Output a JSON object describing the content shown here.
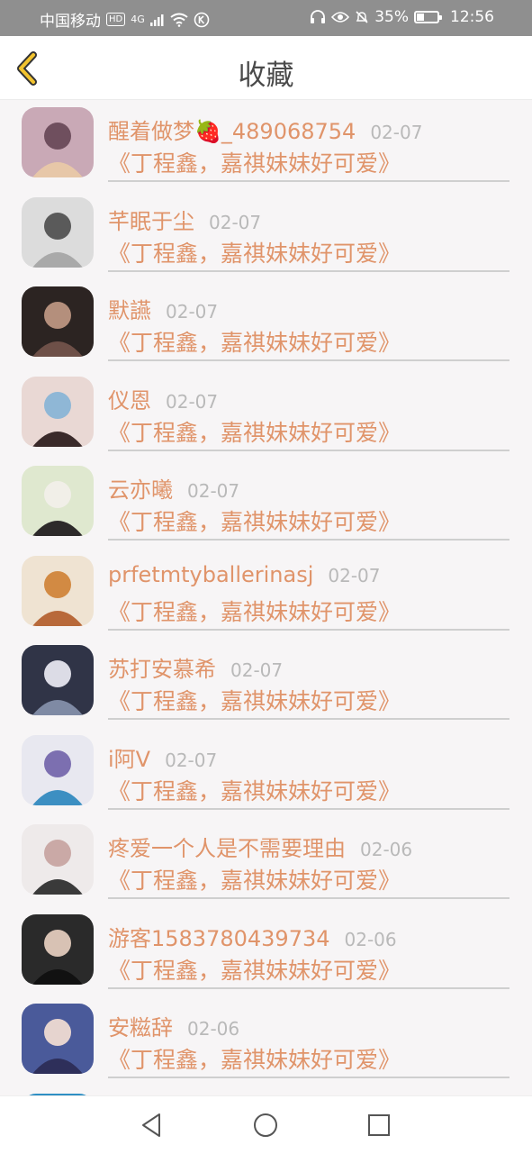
{
  "status_bar": {
    "carrier": "中国移动",
    "hd": "HD",
    "network": "4G",
    "battery_percent": "35%",
    "battery_level": 0.35,
    "time": "12:56"
  },
  "header": {
    "title": "收藏",
    "back_icon": "chevron-left-icon",
    "accent_color": "#f2c32e"
  },
  "colors": {
    "name": "#e0946a",
    "date": "#b9b9b9",
    "divider": "#cfcfcf"
  },
  "items": [
    {
      "name": "醒着做梦🍓_489068754",
      "date": "02-07",
      "title": "《丁程鑫，嘉祺妹妹好可爱》"
    },
    {
      "name": "芊眠于尘",
      "date": "02-07",
      "title": "《丁程鑫，嘉祺妹妹好可爱》"
    },
    {
      "name": "默讌",
      "date": "02-07",
      "title": "《丁程鑫，嘉祺妹妹好可爱》"
    },
    {
      "name": "仪恩",
      "date": "02-07",
      "title": "《丁程鑫，嘉祺妹妹好可爱》"
    },
    {
      "name": "云亦曦",
      "date": "02-07",
      "title": "《丁程鑫，嘉祺妹妹好可爱》"
    },
    {
      "name": "prfetmtyballerinasj",
      "date": "02-07",
      "title": "《丁程鑫，嘉祺妹妹好可爱》"
    },
    {
      "name": "苏打安慕希",
      "date": "02-07",
      "title": "《丁程鑫，嘉祺妹妹好可爱》"
    },
    {
      "name": "i阿V",
      "date": "02-07",
      "title": "《丁程鑫，嘉祺妹妹好可爱》"
    },
    {
      "name": "疼爱一个人是不需要理由",
      "date": "02-06",
      "title": "《丁程鑫，嘉祺妹妹好可爱》"
    },
    {
      "name": "游客1583780439734",
      "date": "02-06",
      "title": "《丁程鑫，嘉祺妹妹好可爱》"
    },
    {
      "name": "安糍辞",
      "date": "02-06",
      "title": "《丁程鑫，嘉祺妹妹好可爱》"
    }
  ],
  "nav": {
    "back": "triangle-back-icon",
    "home": "circle-home-icon",
    "recent": "square-recent-icon"
  }
}
